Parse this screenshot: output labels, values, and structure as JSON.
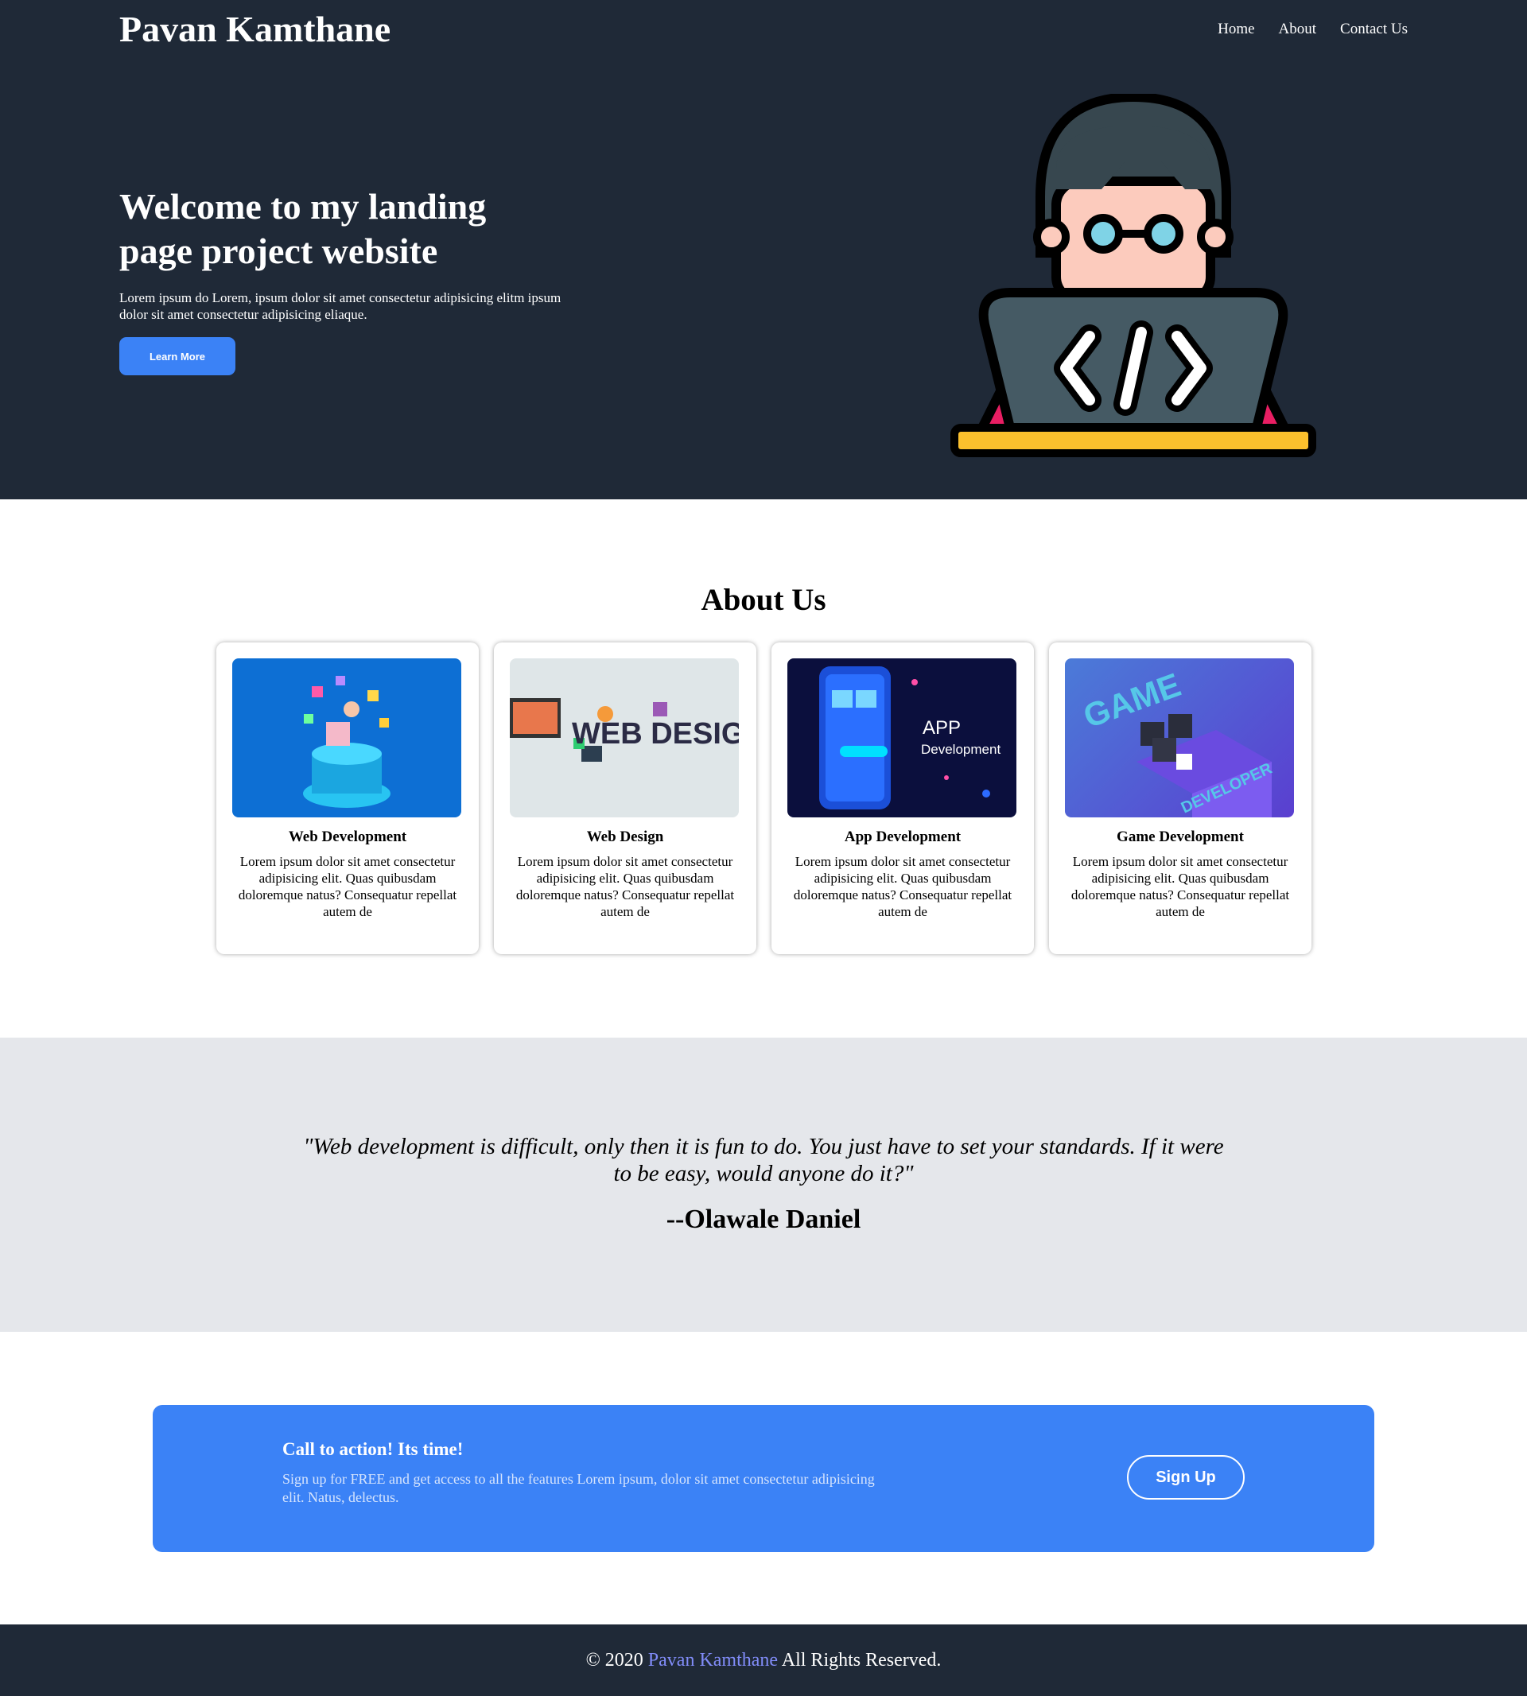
{
  "header": {
    "brand": "Pavan Kamthane",
    "nav": [
      "Home",
      "About",
      "Contact Us"
    ]
  },
  "hero": {
    "title": "Welcome to my landing page project website",
    "subtitle": "Lorem ipsum do Lorem, ipsum dolor sit amet consectetur adipisicing elitm ipsum dolor sit amet consectetur adipisicing eliaque.",
    "button": "Learn More"
  },
  "about": {
    "title": "About Us",
    "cards": [
      {
        "title": "Web Development",
        "text": "Lorem ipsum dolor sit amet consectetur adipisicing elit. Quas quibusdam doloremque natus? Consequatur repellat autem de"
      },
      {
        "title": "Web Design",
        "text": "Lorem ipsum dolor sit amet consectetur adipisicing elit. Quas quibusdam doloremque natus? Consequatur repellat autem de",
        "image_text": "WEB DESIGN"
      },
      {
        "title": "App Development",
        "text": "Lorem ipsum dolor sit amet consectetur adipisicing elit. Quas quibusdam doloremque natus? Consequatur repellat autem de",
        "image_text_1": "APP",
        "image_text_2": "Development"
      },
      {
        "title": "Game Development",
        "text": "Lorem ipsum dolor sit amet consectetur adipisicing elit. Quas quibusdam doloremque natus? Consequatur repellat autem de",
        "image_text_1": "GAME",
        "image_text_2": "DEVELOPER"
      }
    ]
  },
  "quote": {
    "text": "\"Web development is difficult, only then it is fun to do. You just have to set your standards. If it were to be easy, would anyone do it?\"",
    "author": "--Olawale Daniel"
  },
  "cta": {
    "title": "Call to action! Its time!",
    "text": "Sign up for FREE and get access to all the features Lorem ipsum, dolor sit amet consectetur adipisicing elit. Natus, delectus.",
    "button": "Sign Up"
  },
  "footer": {
    "prefix": "© 2020",
    "name": "Pavan Kamthane",
    "suffix": "All Rights Reserved."
  },
  "colors": {
    "dark": "#1f2937",
    "accent": "#3b82f6",
    "quote_bg": "#e5e7eb",
    "footer_link": "#818cf8"
  }
}
